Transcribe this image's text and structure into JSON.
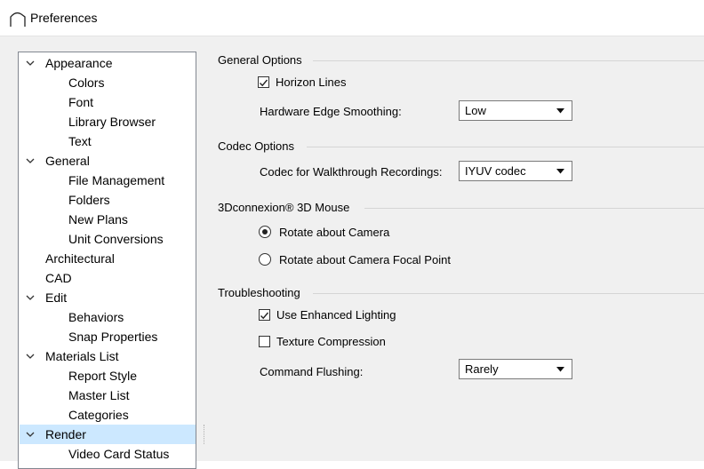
{
  "window": {
    "title": "Preferences",
    "icon": "house-roof-icon"
  },
  "tree": {
    "items": [
      {
        "label": "Appearance",
        "level": 0,
        "expandable": true
      },
      {
        "label": "Colors",
        "level": 1
      },
      {
        "label": "Font",
        "level": 1
      },
      {
        "label": "Library Browser",
        "level": 1
      },
      {
        "label": "Text",
        "level": 1
      },
      {
        "label": "General",
        "level": 0,
        "expandable": true
      },
      {
        "label": "File Management",
        "level": 1
      },
      {
        "label": "Folders",
        "level": 1
      },
      {
        "label": "New Plans",
        "level": 1
      },
      {
        "label": "Unit Conversions",
        "level": 1
      },
      {
        "label": "Architectural",
        "level": 0
      },
      {
        "label": "CAD",
        "level": 0
      },
      {
        "label": "Edit",
        "level": 0,
        "expandable": true
      },
      {
        "label": "Behaviors",
        "level": 1
      },
      {
        "label": "Snap Properties",
        "level": 1
      },
      {
        "label": "Materials List",
        "level": 0,
        "expandable": true
      },
      {
        "label": "Report Style",
        "level": 1
      },
      {
        "label": "Master List",
        "level": 1
      },
      {
        "label": "Categories",
        "level": 1
      },
      {
        "label": "Render",
        "level": 0,
        "expandable": true,
        "selected": true
      },
      {
        "label": "Video Card Status",
        "level": 1
      }
    ]
  },
  "general_options": {
    "title": "General Options",
    "horizon_lines": {
      "label": "Horizon Lines",
      "checked": true
    },
    "edge_smoothing": {
      "label": "Hardware Edge Smoothing:",
      "value": "Low"
    }
  },
  "codec_options": {
    "title": "Codec Options",
    "codec": {
      "label": "Codec for Walkthrough Recordings:",
      "value": "IYUV codec"
    }
  },
  "mouse": {
    "title": "3Dconnexion® 3D Mouse",
    "rotate_camera": {
      "label": "Rotate about Camera",
      "selected": true
    },
    "rotate_focal": {
      "label": "Rotate about Camera Focal Point",
      "selected": false
    }
  },
  "troubleshooting": {
    "title": "Troubleshooting",
    "enhanced_lighting": {
      "label": "Use Enhanced Lighting",
      "checked": true
    },
    "texture_compression": {
      "label": "Texture Compression",
      "checked": false
    },
    "command_flushing": {
      "label": "Command Flushing:",
      "value": "Rarely"
    }
  },
  "colors": {
    "selection": "#cce8ff",
    "panel": "#f0f0f0",
    "border": "#828790"
  }
}
